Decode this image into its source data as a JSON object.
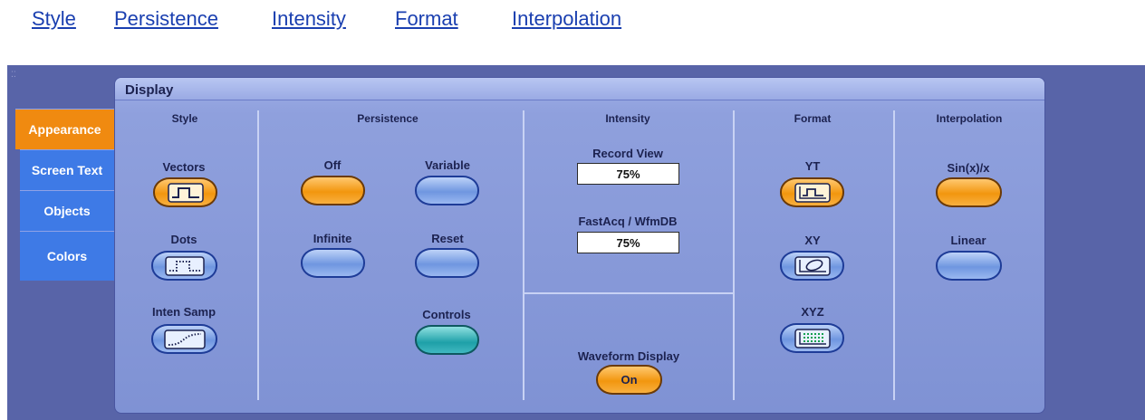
{
  "links": [
    "Style",
    "Persistence",
    "Intensity",
    " Format",
    "Interpolation"
  ],
  "panel_title": "Display",
  "tabs": [
    "Appearance",
    "Screen Text",
    "Objects",
    "Colors"
  ],
  "style": {
    "header": "Style",
    "vectors": "Vectors",
    "dots": "Dots",
    "inten_samp": "Inten Samp"
  },
  "persistence": {
    "header": "Persistence",
    "off": "Off",
    "variable": "Variable",
    "infinite": "Infinite",
    "reset": "Reset",
    "controls": "Controls"
  },
  "intensity": {
    "header": "Intensity",
    "record_view_label": "Record View",
    "record_view_value": "75%",
    "fastacq_label": "FastAcq / WfmDB",
    "fastacq_value": "75%",
    "waveform_display_label": "Waveform Display",
    "waveform_display_value": "On"
  },
  "format": {
    "header": "Format",
    "yt": "YT",
    "xy": "XY",
    "xyz": "XYZ"
  },
  "interpolation": {
    "header": "Interpolation",
    "sinx": "Sin(x)/x",
    "linear": "Linear"
  },
  "colors": {
    "link": "#1a3fb0",
    "outer_bg": "#5864a8",
    "active_tab": "#f08a10",
    "inactive_tab": "#3e7ae6",
    "button_selected": "#f2960e",
    "button_unselected": "#6f96e0",
    "button_teal": "#1ea0a8"
  }
}
